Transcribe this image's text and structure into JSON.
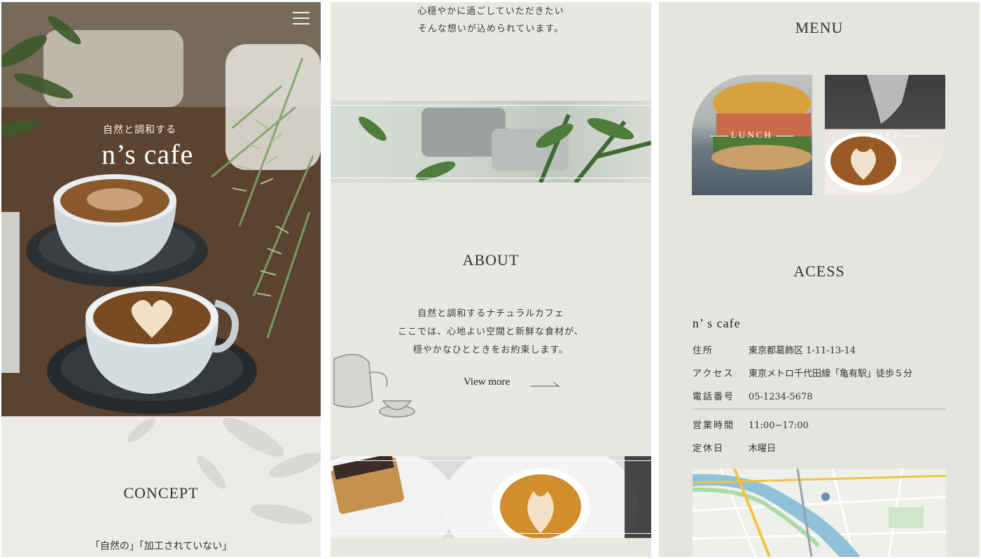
{
  "panel1": {
    "hero_subtitle": "自然と調和する",
    "hero_title": "n’s cafe",
    "concept_title": "CONCEPT",
    "concept_line": "「自然の」「加工されていない」",
    "menu_icon": "hamburger-menu-icon"
  },
  "panel2": {
    "top_text": [
      "心穏やかに過ごしていただきたい",
      "そんな想いが込められています。"
    ],
    "about_title": "ABOUT",
    "about_text": [
      "自然と調和するナチュラルカフェ",
      "ここでは、心地よい空間と新鮮な食材が、",
      "穏やかなひとときをお約束します。"
    ],
    "view_more": "View more"
  },
  "panel3": {
    "menu_title": "MENU",
    "cards": [
      {
        "label": "LUNCH"
      },
      {
        "label": "CAFE"
      }
    ],
    "access_title": "ACESS",
    "shop_name": "n’ s cafe",
    "info": [
      {
        "label": "住所",
        "value": "東京都葛飾区 1-11-13-14"
      },
      {
        "label": "アクセス",
        "value": "東京メトロ千代田線「亀有駅」徒歩５分"
      },
      {
        "label": "電話番号",
        "value": "05-1234-5678"
      },
      {
        "label": "営業時間",
        "value": "11:00−17:00"
      },
      {
        "label": "定休日",
        "value": "木曜日"
      }
    ]
  }
}
